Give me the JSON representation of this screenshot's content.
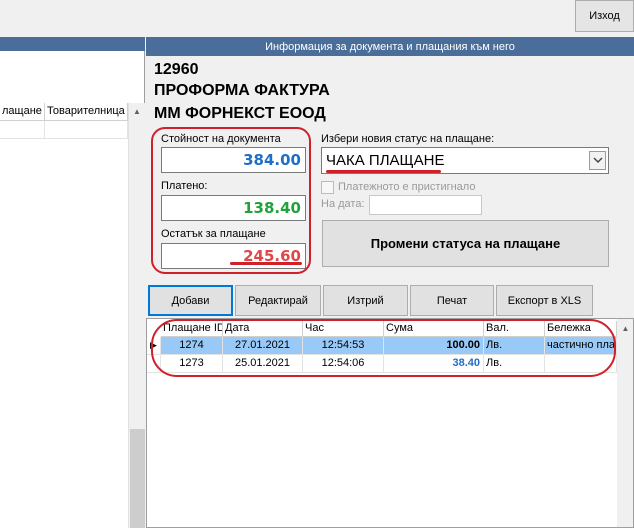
{
  "top": {
    "exit_label": "Изход"
  },
  "left_grid": {
    "columns": [
      "лащане",
      "Товарителница"
    ]
  },
  "info": {
    "header": "Информация за документа и плащания към него",
    "doc_number": "12960",
    "doc_type": "ПРОФОРМА ФАКТУРА",
    "company": "ММ ФОРНЕКСТ ЕООД"
  },
  "amounts": {
    "doc_value_label": "Стойност на документа",
    "doc_value": "384.00",
    "paid_label": "Платено:",
    "paid": "138.40",
    "remaining_label": "Остатък за плащане",
    "remaining": "245.60",
    "colors": {
      "doc_value": "#1f6fc6",
      "paid": "#22a33a",
      "remaining": "#e04848"
    }
  },
  "status": {
    "label": "Избери новия статус на плащане:",
    "value": "ЧАКА ПЛАЩАНЕ",
    "arrived_label": "Платежното е пристигнало",
    "date_label": "На дата:",
    "date_value": "",
    "change_button": "Промени статуса на плащане"
  },
  "toolbar": {
    "add": "Добави",
    "edit": "Редактирай",
    "delete": "Изтрий",
    "print": "Печат",
    "export": "Експорт в XLS"
  },
  "payments": {
    "columns": [
      "Плащане ID",
      "Дата",
      "Час",
      "Сума",
      "Вал.",
      "Бележка"
    ],
    "rows": [
      {
        "id": "1274",
        "date": "27.01.2021",
        "time": "12:54:53",
        "amount": "100.00",
        "currency": "Лв.",
        "note": "частично пла",
        "selected": true
      },
      {
        "id": "1273",
        "date": "25.01.2021",
        "time": "12:54:06",
        "amount": "38.40",
        "currency": "Лв.",
        "note": "",
        "selected": false
      }
    ]
  }
}
